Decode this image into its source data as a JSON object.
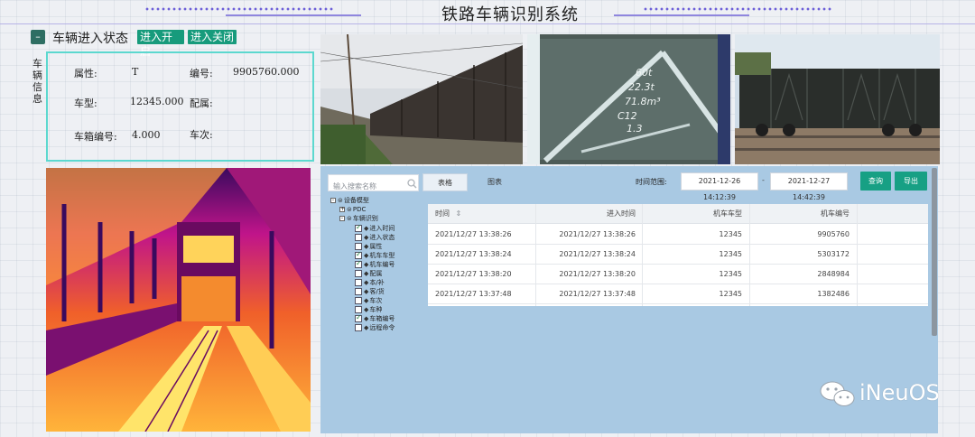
{
  "header": {
    "title": "铁路车辆识别系统"
  },
  "status": {
    "icon": "toggle-icon",
    "label": "车辆进入状态",
    "open_button": "进入开启",
    "close_button": "进入关闭"
  },
  "vehicle_info": {
    "side_label": "车辆信息",
    "fields": [
      {
        "label": "属性:",
        "value": "T"
      },
      {
        "label": "编号:",
        "value": "9905760.000"
      },
      {
        "label": "车型:",
        "value": "12345.000"
      },
      {
        "label": "配属:",
        "value": ""
      },
      {
        "label": "车箱编号:",
        "value": "4.000"
      },
      {
        "label": "车次:",
        "value": ""
      }
    ]
  },
  "toolbar": {
    "search_placeholder": "输入搜索名称",
    "search_icon": "search-icon",
    "tabs": [
      "表格",
      "图表"
    ],
    "range_label": "时间范围:",
    "date_from": "2021-12-26 14:12:39",
    "date_separator": "-",
    "date_to": "2021-12-27 14:42:39",
    "query_button": "查询",
    "export_button": "导出"
  },
  "tree": {
    "root": "设备模型",
    "nodes": [
      {
        "label": "PDC",
        "toggle": "+"
      },
      {
        "label": "车辆识别",
        "toggle": "-"
      }
    ],
    "children": [
      {
        "label": "进入时间",
        "checked": true
      },
      {
        "label": "进入状态",
        "checked": false
      },
      {
        "label": "属性",
        "checked": false
      },
      {
        "label": "机车车型",
        "checked": true
      },
      {
        "label": "机车编号",
        "checked": true
      },
      {
        "label": "配属",
        "checked": false
      },
      {
        "label": "本/补",
        "checked": false
      },
      {
        "label": "客/货",
        "checked": false
      },
      {
        "label": "车次",
        "checked": false
      },
      {
        "label": "车种",
        "checked": false
      },
      {
        "label": "车箱编号",
        "checked": true
      },
      {
        "label": "远程命令",
        "checked": false
      }
    ]
  },
  "table": {
    "headers": [
      "时间",
      "进入时间",
      "机车车型",
      "机车编号"
    ],
    "sort_icon": "sort-icon",
    "rows": [
      [
        "2021/12/27 13:38:26",
        "2021/12/27 13:38:26",
        "12345",
        "9905760"
      ],
      [
        "2021/12/27 13:38:24",
        "2021/12/27 13:38:24",
        "12345",
        "5303172"
      ],
      [
        "2021/12/27 13:38:20",
        "2021/12/27 13:38:20",
        "12345",
        "2848984"
      ],
      [
        "2021/12/27 13:37:48",
        "2021/12/27 13:37:48",
        "12345",
        "1382486"
      ]
    ]
  },
  "watermark": {
    "text": "iNeuOS",
    "icon": "wechat-icon"
  }
}
